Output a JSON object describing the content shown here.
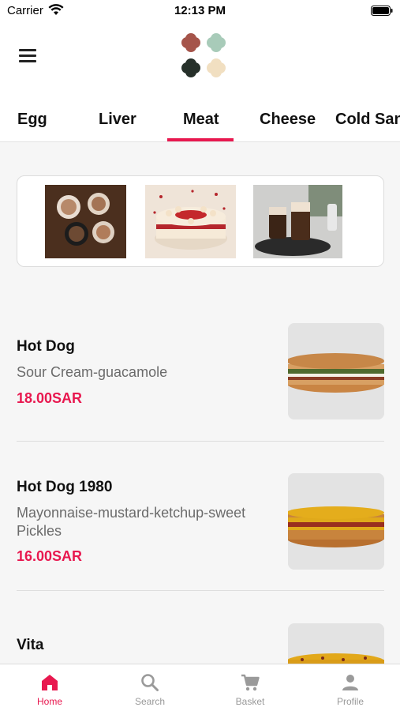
{
  "status_bar": {
    "carrier": "Carrier",
    "time": "12:13 PM"
  },
  "header": {
    "menu_icon": "hamburger-menu-icon",
    "logo_colors": [
      "#a5544a",
      "#a8cbb9",
      "#26302a",
      "#f1dfc1"
    ]
  },
  "categories": {
    "items": [
      "Egg",
      "Liver",
      "Meat",
      "Cheese",
      "Cold Sandwiches"
    ],
    "visible_labels": [
      "Egg",
      "Liver",
      "Meat",
      "Cheese",
      "Cold San"
    ],
    "selected": "Meat"
  },
  "banner": {
    "images": [
      "coffee-cups-image",
      "red-velvet-cake-image",
      "iced-coffee-glasses-image"
    ]
  },
  "products": [
    {
      "name": "Hot Dog",
      "description": "Sour Cream-guacamole",
      "price": "18.00SAR"
    },
    {
      "name": "Hot Dog 1980",
      "description": "Mayonnaise-mustard-ketchup-sweet Pickles",
      "price": "16.00SAR"
    },
    {
      "name": "Vita",
      "description": "",
      "price": ""
    }
  ],
  "bottom_nav": {
    "items": [
      {
        "label": "Home",
        "icon": "home-icon",
        "active": true
      },
      {
        "label": "Search",
        "icon": "search-icon",
        "active": false
      },
      {
        "label": "Basket",
        "icon": "cart-icon",
        "active": false
      },
      {
        "label": "Profile",
        "icon": "person-icon",
        "active": false
      }
    ]
  },
  "colors": {
    "accent": "#e8184f",
    "inactive": "#999999"
  }
}
